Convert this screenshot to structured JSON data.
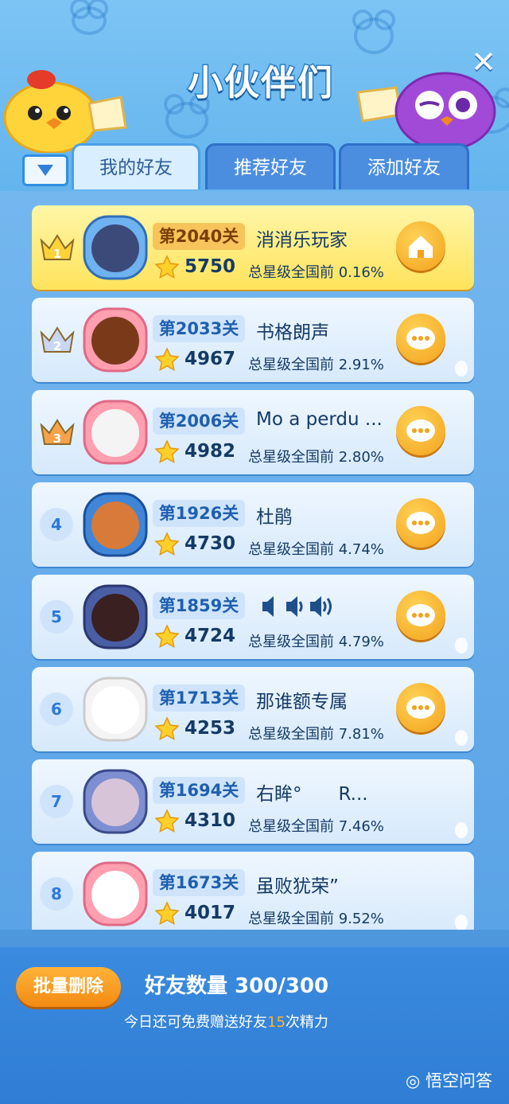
{
  "header": {
    "title": "小伙伴们",
    "close_icon": "close-icon"
  },
  "tabs": [
    {
      "label": "我的好友",
      "active": true
    },
    {
      "label": "推荐好友",
      "active": false
    },
    {
      "label": "添加好友",
      "active": false
    }
  ],
  "friends": [
    {
      "rank": "1",
      "level": "第2040关",
      "name": "消消乐玩家",
      "stars": "5750",
      "percentile": "总星级全国前 0.16%",
      "action": "home-icon",
      "self": true
    },
    {
      "rank": "2",
      "level": "第2033关",
      "name": "书格朗声",
      "stars": "4967",
      "percentile": "总星级全国前 2.91%",
      "action": "chat-icon"
    },
    {
      "rank": "3",
      "level": "第2006关",
      "name": "Mo a perdu ...",
      "stars": "4982",
      "percentile": "总星级全国前 2.80%",
      "action": "chat-icon"
    },
    {
      "rank": "4",
      "level": "第1926关",
      "name": "杜鹃",
      "stars": "4730",
      "percentile": "总星级全国前 4.74%",
      "action": "chat-icon"
    },
    {
      "rank": "5",
      "level": "第1859关",
      "name": "",
      "stars": "4724",
      "percentile": "总星级全国前 4.79%",
      "action": "chat-icon"
    },
    {
      "rank": "6",
      "level": "第1713关",
      "name": "那谁额专属",
      "stars": "4253",
      "percentile": "总星级全国前 7.81%",
      "action": "chat-icon"
    },
    {
      "rank": "7",
      "level": "第1694关",
      "name": "右眸°　　R...",
      "stars": "4310",
      "percentile": "总星级全国前 7.46%",
      "action": ""
    },
    {
      "rank": "8",
      "level": "第1673关",
      "name": "虽败犹荣”",
      "stars": "4017",
      "percentile": "总星级全国前 9.52%",
      "action": ""
    }
  ],
  "footer": {
    "batch_delete": "批量删除",
    "friend_count": "好友数量 300/300",
    "gift_prefix": "今日还可免费赠送好友",
    "gift_count": "15",
    "gift_suffix": "次精力",
    "watermark": "悟空问答"
  },
  "colors": {
    "accent": "#f3a21b",
    "header_blue": "#64b4ee",
    "highlight_row": "#ffe35c"
  }
}
